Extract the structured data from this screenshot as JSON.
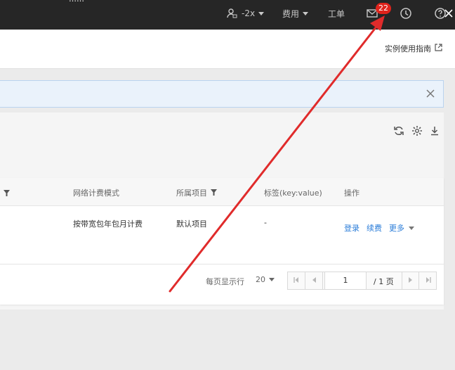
{
  "topbar": {
    "cut_text": "……",
    "account_label": "-2x",
    "billing_label": "费用",
    "ticket_label": "工单",
    "message_count": "22",
    "icons": [
      "user-icon",
      "mail-icon",
      "clock-icon",
      "help-icon",
      "close-icon"
    ]
  },
  "header": {
    "guide_label": "实例使用指南"
  },
  "table": {
    "columns": {
      "network_billing": "网络计费模式",
      "project": "所属项目",
      "tags": "标签(key:value)",
      "actions": "操作"
    },
    "row": {
      "network_billing": "按带宽包年包月计费",
      "project": "默认项目",
      "tags": "-",
      "action_login": "登录",
      "action_renew": "续费",
      "action_more": "更多"
    }
  },
  "pagination": {
    "rows_per_page_label": "每页显示行",
    "rows_per_page": "20",
    "page_input": "1",
    "total_pages": "/ 1 页"
  },
  "annotation": {
    "arrow_color": "#e02b2b"
  }
}
